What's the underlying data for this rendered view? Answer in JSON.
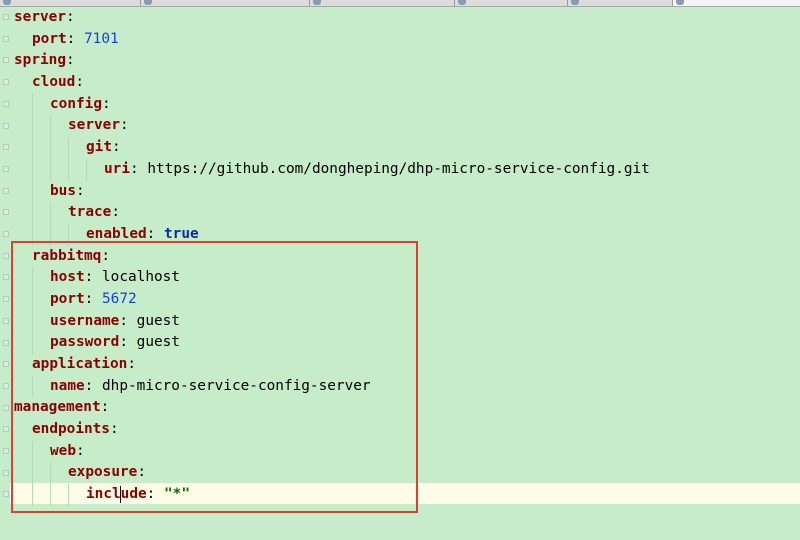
{
  "colors": {
    "editor_background": "#c7ecc9",
    "key": "#8b0000",
    "number": "#1640e6",
    "highlight_box": "#e04030",
    "current_line": "#fdfce6"
  },
  "editor": {
    "language": "yaml",
    "caret_line": 23,
    "lines": [
      {
        "indent": 0,
        "key": "server"
      },
      {
        "indent": 1,
        "key": "port",
        "value": "7101",
        "type": "num"
      },
      {
        "indent": 0,
        "key": "spring"
      },
      {
        "indent": 1,
        "key": "cloud"
      },
      {
        "indent": 2,
        "key": "config"
      },
      {
        "indent": 3,
        "key": "server"
      },
      {
        "indent": 4,
        "key": "git"
      },
      {
        "indent": 5,
        "key": "uri",
        "value": "https://github.com/dongheping/dhp-micro-service-config.git",
        "type": "val"
      },
      {
        "indent": 2,
        "key": "bus"
      },
      {
        "indent": 3,
        "key": "trace"
      },
      {
        "indent": 4,
        "key": "enabled",
        "value": "true",
        "type": "bool"
      },
      {
        "indent": 1,
        "key": "rabbitmq"
      },
      {
        "indent": 2,
        "key": "host",
        "value": "localhost",
        "type": "val"
      },
      {
        "indent": 2,
        "key": "port",
        "value": "5672",
        "type": "num"
      },
      {
        "indent": 2,
        "key": "username",
        "value": "guest",
        "type": "val"
      },
      {
        "indent": 2,
        "key": "password",
        "value": "guest",
        "type": "val"
      },
      {
        "indent": 1,
        "key": "application"
      },
      {
        "indent": 2,
        "key": "name",
        "value": "dhp-micro-service-config-server",
        "type": "val"
      },
      {
        "indent": 0,
        "key": "management"
      },
      {
        "indent": 1,
        "key": "endpoints"
      },
      {
        "indent": 2,
        "key": "web"
      },
      {
        "indent": 3,
        "key": "exposure"
      },
      {
        "indent": 4,
        "key": "include",
        "value": "\"*\"",
        "type": "str"
      }
    ]
  }
}
